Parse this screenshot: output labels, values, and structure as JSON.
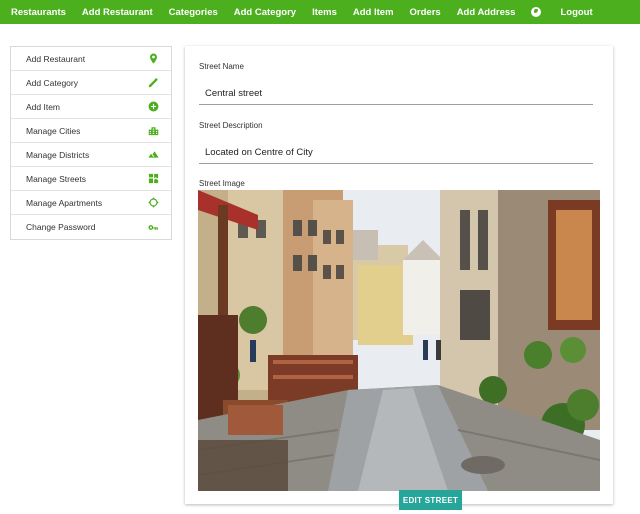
{
  "nav": {
    "items": [
      "Restaurants",
      "Add Restaurant",
      "Categories",
      "Add Category",
      "Items",
      "Add Item",
      "Orders",
      "Add Address"
    ],
    "logout": "Logout",
    "globe_icon": "globe-icon"
  },
  "sidebar": {
    "items": [
      {
        "label": "Add Restaurant",
        "icon": "map-pin-icon"
      },
      {
        "label": "Add Category",
        "icon": "pencil-icon"
      },
      {
        "label": "Add Item",
        "icon": "plus-circle-icon"
      },
      {
        "label": "Manage Cities",
        "icon": "city-icon"
      },
      {
        "label": "Manage Districts",
        "icon": "mountains-icon"
      },
      {
        "label": "Manage Streets",
        "icon": "street-map-icon"
      },
      {
        "label": "Manage Apartments",
        "icon": "compass-icon"
      },
      {
        "label": "Change Password",
        "icon": "key-icon"
      }
    ]
  },
  "form": {
    "street_name_label": "Street Name",
    "street_name_value": "Central street",
    "street_description_label": "Street Description",
    "street_description_value": "Located on Centre of City",
    "street_image_label": "Street Image",
    "submit_label": "EDIT STREET"
  },
  "colors": {
    "primary": "#4caf1e",
    "button": "#26a69a"
  }
}
